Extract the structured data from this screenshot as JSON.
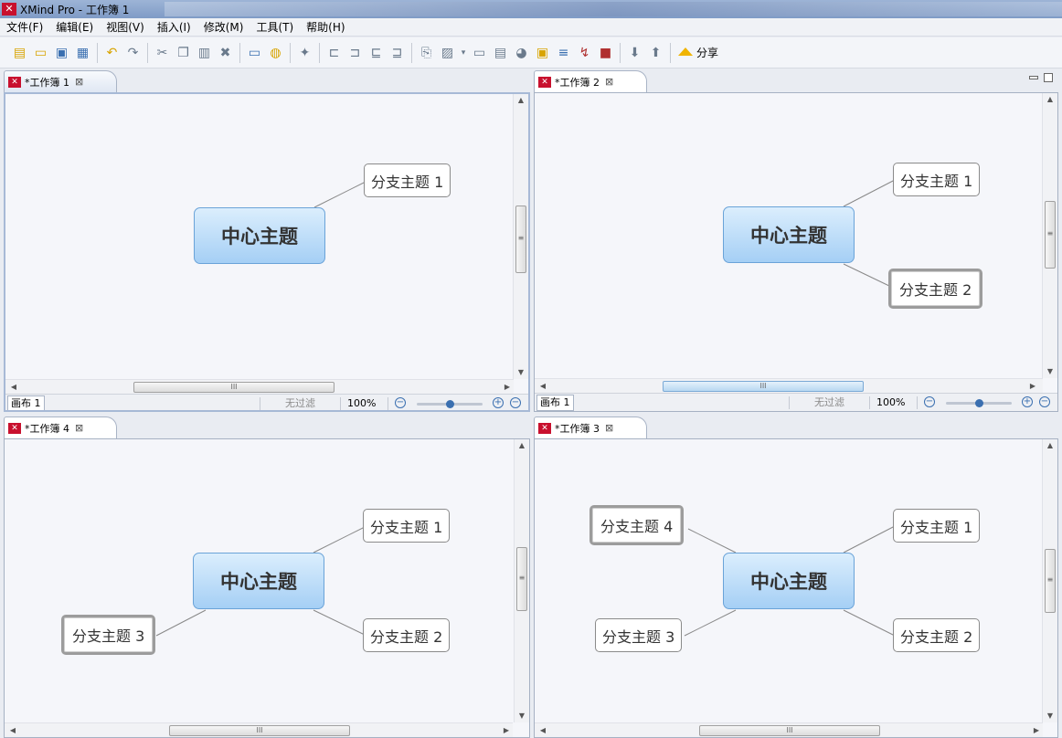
{
  "window": {
    "title": "XMind Pro - 工作簿 1",
    "app_icon": "xmind-icon"
  },
  "menubar": [
    "文件(F)",
    "编辑(E)",
    "视图(V)",
    "插入(I)",
    "修改(M)",
    "工具(T)",
    "帮助(H)"
  ],
  "toolbar": {
    "share_label": "分享"
  },
  "panes": [
    {
      "tab": "*工作簿 1",
      "sheet": "画布 1",
      "filter": "无过滤",
      "zoom": "100%",
      "zoom_level": 0.5,
      "central": "中心主题",
      "topics": [
        "分支主题 1"
      ]
    },
    {
      "tab": "*工作簿 2",
      "sheet": "画布 1",
      "filter": "无过滤",
      "zoom": "100%",
      "zoom_level": 0.5,
      "central": "中心主题",
      "topics": [
        "分支主题 1",
        "分支主题 2"
      ]
    },
    {
      "tab": "*工作簿 4",
      "central": "中心主题",
      "topics": [
        "分支主题 1",
        "分支主题 2",
        "分支主题 3"
      ]
    },
    {
      "tab": "*工作簿 3",
      "central": "中心主题",
      "topics": [
        "分支主题 1",
        "分支主题 2",
        "分支主题 3",
        "分支主题 4"
      ]
    }
  ],
  "colors": {
    "central_fill": "#a5cff5",
    "brand": "#c8102e"
  }
}
